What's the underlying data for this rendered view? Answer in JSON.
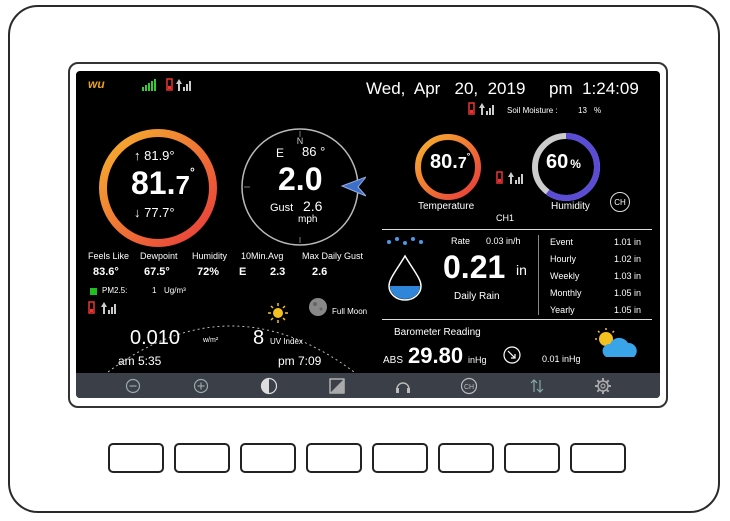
{
  "header": {
    "logo_text": "wu",
    "datetime": "Wed,  Apr   20,  2019     pm  1:24:09",
    "soil_moisture_label": "Soil Moisture :",
    "soil_moisture_value": "13",
    "soil_moisture_unit": "%"
  },
  "outdoor": {
    "temp_high": "↑ 81.9°",
    "temp_main": "81.",
    "temp_decimal": "7",
    "temp_unit": "°",
    "temp_low": "↓ 77.7°"
  },
  "wind": {
    "direction": "E",
    "direction_deg": "86 °",
    "speed": "2.0",
    "gust_label": "Gust",
    "gust_value": "2.6",
    "unit": "mph",
    "compass_marks": [
      "N",
      "E",
      "S",
      "W"
    ]
  },
  "indoor": {
    "temp_main": "80.",
    "temp_decimal": "7",
    "temp_unit": "°",
    "temp_label": "Temperature",
    "humidity_value": "60",
    "humidity_unit": "%",
    "humidity_label": "Humidity",
    "channel": "CH1",
    "ch_button": "CH",
    "humidity_fraction": 0.6
  },
  "stats": {
    "labels": [
      "Feels Like",
      "Dewpoint",
      "Humidity",
      "10Min.Avg",
      "Max Daily Gust"
    ],
    "values": [
      "83.6°",
      "67.5°",
      "72%",
      "E",
      "2.3",
      "2.6"
    ]
  },
  "pm25": {
    "label": "PM2.5:",
    "value": "1",
    "unit": "Ug/m³"
  },
  "moon": {
    "label": "Full Moon"
  },
  "solar": {
    "value": "0.010",
    "unit": "w/m²",
    "uv_value": "8",
    "uv_label": "UV Index",
    "sunrise": "am 5:35",
    "sunset": "pm 7:09"
  },
  "rain": {
    "rate_label": "Rate",
    "rate_value": "0.03 in/h",
    "daily_value": "0.21",
    "daily_unit": "in",
    "daily_label": "Daily Rain",
    "rows": [
      {
        "label": "Event",
        "value": "1.01 in"
      },
      {
        "label": "Hourly",
        "value": "1.02 in"
      },
      {
        "label": "Weekly",
        "value": "1.03 in"
      },
      {
        "label": "Monthly",
        "value": "1.05 in"
      },
      {
        "label": "Yearly",
        "value": "1.05 in"
      }
    ]
  },
  "barometer": {
    "label": "Barometer Reading",
    "abs_label": "ABS",
    "value": "29.80",
    "unit": "inHg",
    "trend_value": "0.01 inHg"
  },
  "colors": {
    "outdoor_ring_start": "#f4a52a",
    "outdoor_ring_end": "#e8393b",
    "humidity_ring": "#5b4cd6",
    "pm_green": "#20c020",
    "toolbar_bg": "#3a3f48",
    "rain_blue": "#2f86d8"
  },
  "toolbar": {
    "icons": [
      "minus-circle-icon",
      "plus-circle-icon",
      "contrast-icon",
      "brightness-icon",
      "headset-icon",
      "ch-icon",
      "sort-arrows-icon",
      "gear-icon"
    ]
  },
  "hardware_buttons": 8
}
